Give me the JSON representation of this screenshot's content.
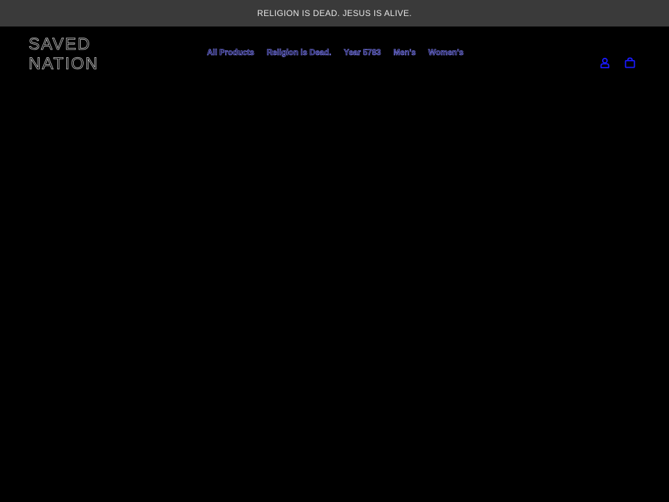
{
  "announcement": {
    "text": "RELIGION IS DEAD. JESUS IS ALIVE."
  },
  "header": {
    "logo_line_1": "SAVED",
    "logo_line_2": "NATION",
    "nav": [
      {
        "label": "All Products"
      },
      {
        "label": "Religion is Dead."
      },
      {
        "label": "Year 5783"
      },
      {
        "label": "Men's"
      },
      {
        "label": "Women's"
      }
    ],
    "icons": {
      "account": "account-icon",
      "cart": "cart-icon"
    }
  },
  "colors": {
    "background": "#000000",
    "announcement_bg": "#3a3a3a",
    "announcement_text": "#e8e8e8",
    "nav_link": "#8a8aff",
    "icon": "#1a1aff"
  }
}
